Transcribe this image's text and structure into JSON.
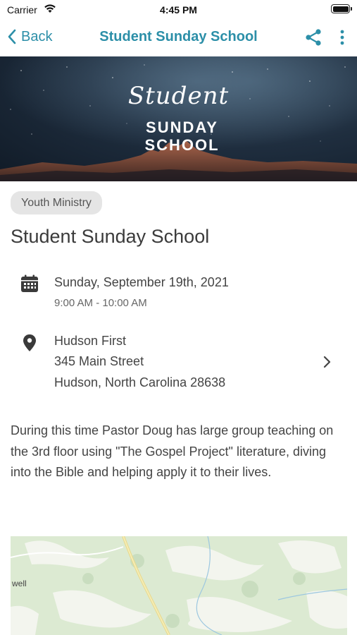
{
  "status_bar": {
    "carrier": "Carrier",
    "time": "4:45 PM"
  },
  "nav": {
    "back_label": "Back",
    "title": "Student Sunday School",
    "accent_color": "#2c8fa8",
    "icons": [
      "chevron-left-icon",
      "share-icon",
      "more-vertical-icon"
    ]
  },
  "banner": {
    "script_text": "Student",
    "line1": "SUNDAY",
    "line2": "SCHOOL"
  },
  "event": {
    "category": "Youth Ministry",
    "title": "Student Sunday School",
    "date": "Sunday, September 19th, 2021",
    "time": "9:00 AM - 10:00 AM",
    "location": {
      "name": "Hudson First",
      "street": "345 Main Street",
      "city_state_zip": "Hudson, North Carolina 28638"
    },
    "description": "During this time Pastor Doug has large group teaching on the 3rd floor using \"The Gospel Project\" literature, diving into the Bible and helping apply it to their lives."
  },
  "map": {
    "visible_label": "well"
  }
}
